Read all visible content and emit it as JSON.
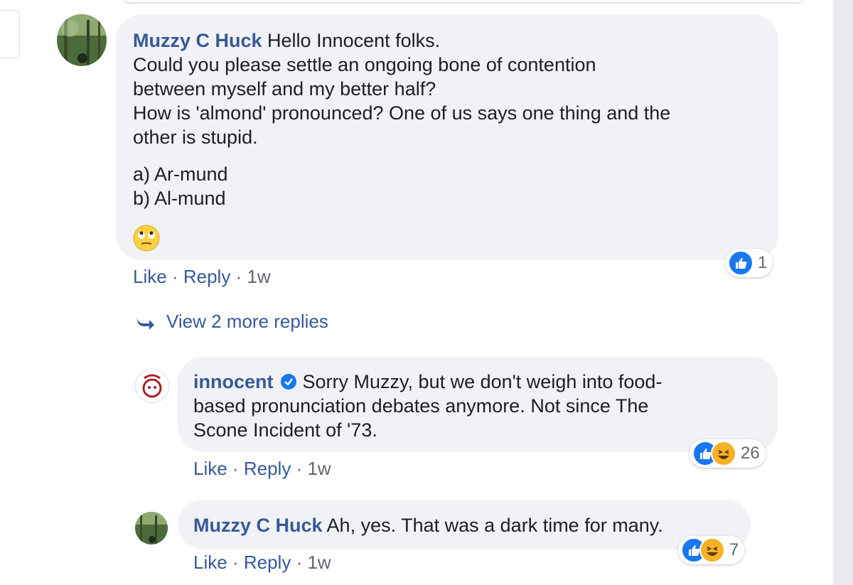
{
  "comments": [
    {
      "author": "Muzzy C Huck",
      "lines": [
        "Hello Innocent folks.",
        "Could you please settle an ongoing bone of contention",
        "between myself and my better half?",
        "How is 'almond' pronounced? One of us says one thing and the",
        "other is stupid.",
        "a) Ar-mund",
        "b) Al-mund"
      ],
      "emoji": "face-with-rolling-eyes",
      "actions": {
        "like": "Like",
        "reply": "Reply",
        "sep": "·",
        "time": "1w"
      },
      "reactions": {
        "icons": [
          "like"
        ],
        "count": "1"
      }
    },
    {
      "author": "innocent",
      "verified": true,
      "lines": [
        "Sorry Muzzy, but we don't weigh into food-",
        "based pronunciation debates anymore. Not since The",
        "Scone Incident of '73."
      ],
      "actions": {
        "like": "Like",
        "reply": "Reply",
        "sep": "·",
        "time": "1w"
      },
      "reactions": {
        "icons": [
          "like",
          "haha"
        ],
        "count": "26"
      }
    },
    {
      "author": "Muzzy C Huck",
      "lines": [
        "Ah, yes. That was a dark time for many."
      ],
      "actions": {
        "like": "Like",
        "reply": "Reply",
        "sep": "·",
        "time": "1w"
      },
      "reactions": {
        "icons": [
          "like",
          "haha"
        ],
        "count": "7"
      }
    }
  ],
  "view_more": {
    "label": "View 2 more replies",
    "icon": "reply-arrow-icon"
  },
  "colors": {
    "link": "#385898",
    "bubble": "#f0f2f5",
    "like_blue": "#1877f2",
    "haha_yellow": "#f7b125",
    "brand_red": "#a5222a"
  }
}
